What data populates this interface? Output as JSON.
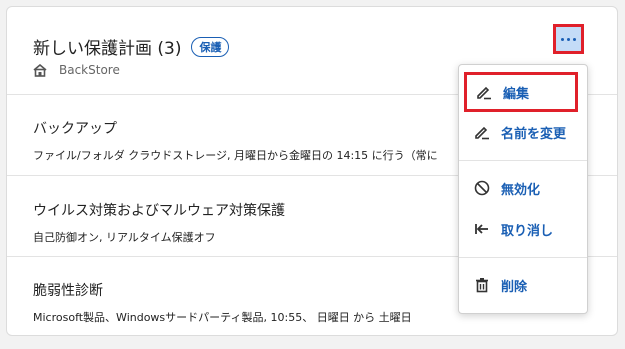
{
  "plan": {
    "title": "新しい保護計画 (3)",
    "badge": "保護",
    "store_icon": "building-icon",
    "store": "BackStore"
  },
  "sections": [
    {
      "title": "バックアップ",
      "desc": "ファイル/フォルダ クラウドストレージ, 月曜日から金曜日の 14:15 に行う（常に"
    },
    {
      "title": "ウイルス対策およびマルウェア対策保護",
      "desc": "自己防御オン, リアルタイム保護オフ"
    },
    {
      "title": "脆弱性診断",
      "desc": "Microsoft製品、Windowsサードパーティ製品, 10:55、 日曜日 から 土曜日"
    }
  ],
  "menu": {
    "edit": "編集",
    "rename": "名前を変更",
    "disable": "無効化",
    "revoke": "取り消し",
    "delete": "削除"
  },
  "colors": {
    "accent": "#1a5fb4",
    "highlight": "#e0202a",
    "button_bg": "#c4dcf7"
  }
}
